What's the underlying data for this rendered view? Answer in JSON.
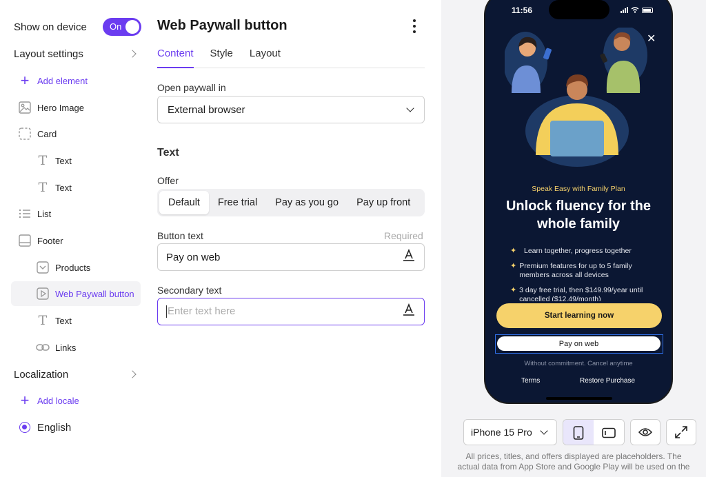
{
  "sidebar": {
    "show_on_device": "Show on device",
    "toggle_label": "On",
    "layout_settings": "Layout settings",
    "add_element": "Add element",
    "items": [
      {
        "label": "Hero Image",
        "icon": "image-icon"
      },
      {
        "label": "Card",
        "icon": "card-icon"
      },
      {
        "label": "Text",
        "icon": "text-icon"
      },
      {
        "label": "Text",
        "icon": "text-icon"
      },
      {
        "label": "List",
        "icon": "list-icon"
      },
      {
        "label": "Footer",
        "icon": "footer-icon"
      },
      {
        "label": "Products",
        "icon": "products-icon"
      },
      {
        "label": "Web Paywall button",
        "icon": "play-button-icon"
      },
      {
        "label": "Text",
        "icon": "text-icon"
      },
      {
        "label": "Links",
        "icon": "link-icon"
      }
    ],
    "localization": "Localization",
    "add_locale": "Add locale",
    "locale": "English"
  },
  "panel": {
    "title": "Web Paywall button",
    "tabs": [
      "Content",
      "Style",
      "Layout"
    ],
    "open_paywall_label": "Open paywall in",
    "open_paywall_value": "External browser",
    "section_text": "Text",
    "offer_label": "Offer",
    "offers": [
      "Default",
      "Free trial",
      "Pay as you go",
      "Pay up front"
    ],
    "button_text_label": "Button text",
    "required": "Required",
    "button_text_value": "Pay on web",
    "secondary_text_label": "Secondary text",
    "secondary_text_placeholder": "Enter text here"
  },
  "phone": {
    "time": "11:56",
    "subtitle": "Speak Easy with Family Plan",
    "headline": "Unlock fluency for the whole family",
    "features": [
      "Learn together, progress together",
      "Premium features for up to 5 family members across all devices",
      "3 day free trial, then $149.99/year until cancelled ($12.49/month)"
    ],
    "primary_button": "Start learning now",
    "web_button": "Pay on web",
    "commitment": "Without commitment. Cancel anytime",
    "terms": "Terms",
    "restore": "Restore Purchase"
  },
  "preview_controls": {
    "device": "iPhone 15 Pro",
    "note": "All prices, titles, and offers displayed are placeholders. The actual data from App Store and Google Play will be used on the"
  },
  "colors": {
    "accent": "#6b3cf0",
    "phone_bg": "#0b1733",
    "cta": "#f6d26b"
  }
}
